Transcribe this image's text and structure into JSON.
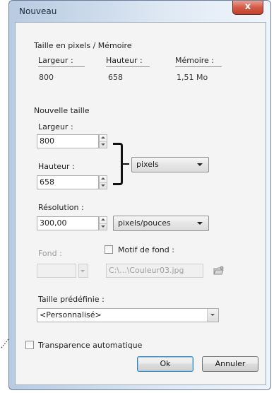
{
  "window": {
    "title": "Nouveau",
    "close_glyph": "x"
  },
  "pixel_size": {
    "heading": "Taille en pixels / Mémoire",
    "width_label": "Largeur :",
    "height_label": "Hauteur :",
    "memory_label": "Mémoire :",
    "width_value": "800",
    "height_value": "658",
    "memory_value": "1,51 Mo"
  },
  "new_size": {
    "heading": "Nouvelle taille",
    "width_label": "Largeur :",
    "width_value": "800",
    "height_label": "Hauteur :",
    "height_value": "658",
    "unit_selected": "pixels",
    "resolution_label": "Résolution :",
    "resolution_value": "300,00",
    "resolution_unit_selected": "pixels/pouces"
  },
  "background": {
    "fond_label": "Fond :",
    "motif_label": "Motif de fond :",
    "motif_path": "C:\\...\\Couleur03.jpg"
  },
  "preset": {
    "label": "Taille prédéfinie :",
    "selected": "<Personnalisé>"
  },
  "auto_transparency_label": "Transparence automatique",
  "buttons": {
    "ok": "Ok",
    "cancel": "Annuler"
  },
  "colors": {
    "frame": "#6a7f9b",
    "close_red": "#c2402b",
    "client_bg": "#f4f4f4"
  }
}
